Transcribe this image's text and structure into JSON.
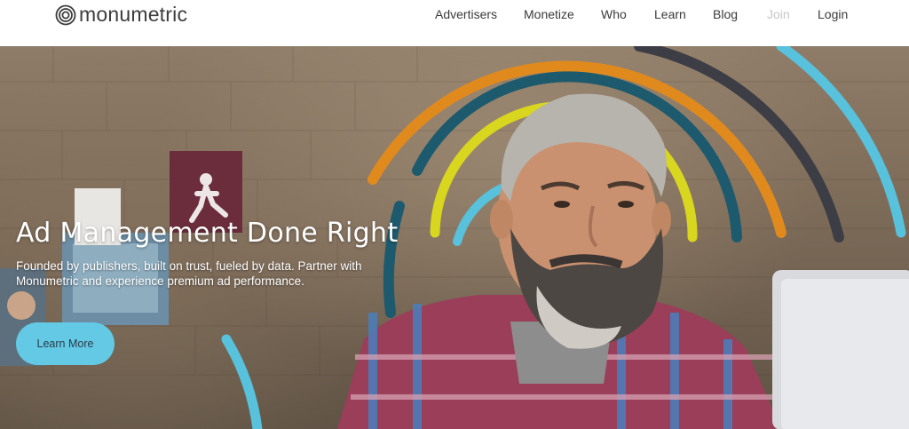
{
  "brand": {
    "name": "monumetric",
    "logo_icon": "concentric-circles-icon"
  },
  "nav": {
    "items": [
      {
        "label": "Advertisers"
      },
      {
        "label": "Monetize"
      },
      {
        "label": "Who"
      },
      {
        "label": "Learn"
      },
      {
        "label": "Blog"
      },
      {
        "label": "Join",
        "state": "muted"
      },
      {
        "label": "Login"
      }
    ]
  },
  "hero": {
    "title": "Ad Management Done Right",
    "subtitle": "Founded by publishers, built on trust, fueled by data. Partner with Monumetric and experience premium ad performance.",
    "cta_label": "Learn More"
  },
  "colors": {
    "cta_background": "#63c9e4",
    "arc_orange": "#e08a1e",
    "arc_teal": "#1d5a6d",
    "arc_yellow": "#d8d61e",
    "arc_light_blue": "#58c1dc",
    "arc_charcoal": "#3d3d45"
  }
}
